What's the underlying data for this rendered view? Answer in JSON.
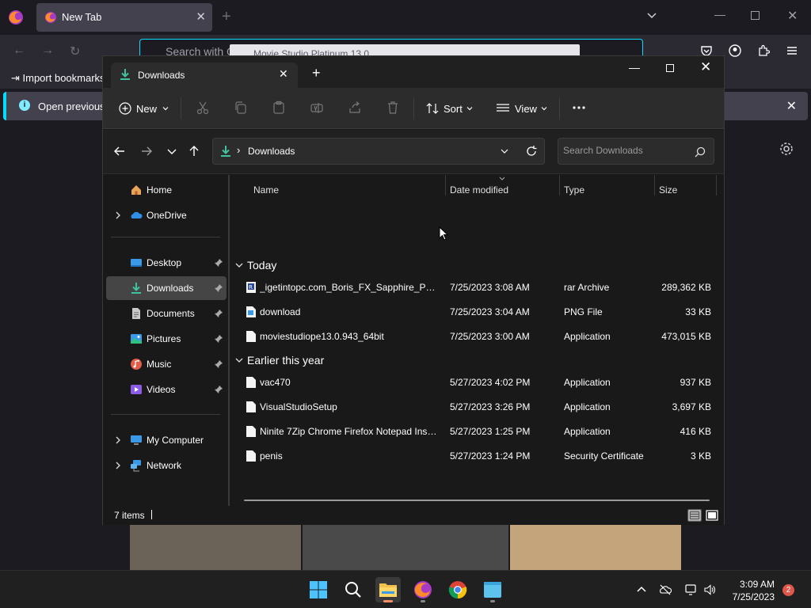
{
  "browser": {
    "tab_title": "New Tab",
    "url_placeholder": "Search with G",
    "url_suggestion": "Movie Studio Platinum 13.0",
    "import_bookmarks": "Import bookmarks...",
    "infobar_text": "Open previous t"
  },
  "explorer": {
    "tab_title": "Downloads",
    "toolbar": {
      "new_label": "New",
      "sort_label": "Sort",
      "view_label": "View"
    },
    "address": {
      "path": "Downloads",
      "search_placeholder": "Search Downloads"
    },
    "sidebar": {
      "items": [
        {
          "label": "Home",
          "icon": "home-icon"
        },
        {
          "label": "OneDrive",
          "icon": "onedrive-icon"
        },
        {
          "label": "Desktop",
          "icon": "desktop-icon"
        },
        {
          "label": "Downloads",
          "icon": "downloads-icon"
        },
        {
          "label": "Documents",
          "icon": "documents-icon"
        },
        {
          "label": "Pictures",
          "icon": "pictures-icon"
        },
        {
          "label": "Music",
          "icon": "music-icon"
        },
        {
          "label": "Videos",
          "icon": "videos-icon"
        },
        {
          "label": "My Computer",
          "icon": "computer-icon"
        },
        {
          "label": "Network",
          "icon": "network-icon"
        }
      ]
    },
    "columns": {
      "name": "Name",
      "date": "Date modified",
      "type": "Type",
      "size": "Size"
    },
    "groups": [
      {
        "label": "Today",
        "files": [
          {
            "name": "_igetintopc.com_Boris_FX_Sapphire_Plug...",
            "date": "7/25/2023 3:08 AM",
            "type": "rar Archive",
            "size": "289,362 KB"
          },
          {
            "name": "download",
            "date": "7/25/2023 3:04 AM",
            "type": "PNG File",
            "size": "33 KB"
          },
          {
            "name": "moviestudiope13.0.943_64bit",
            "date": "7/25/2023 3:00 AM",
            "type": "Application",
            "size": "473,015 KB"
          }
        ]
      },
      {
        "label": "Earlier this year",
        "files": [
          {
            "name": "vac470",
            "date": "5/27/2023 4:02 PM",
            "type": "Application",
            "size": "937 KB"
          },
          {
            "name": "VisualStudioSetup",
            "date": "5/27/2023 3:26 PM",
            "type": "Application",
            "size": "3,697 KB"
          },
          {
            "name": "Ninite 7Zip Chrome Firefox Notepad Inst...",
            "date": "5/27/2023 1:25 PM",
            "type": "Application",
            "size": "416 KB"
          },
          {
            "name": "penis",
            "date": "5/27/2023 1:24 PM",
            "type": "Security Certificate",
            "size": "3 KB"
          }
        ]
      }
    ],
    "status": {
      "item_count": "7 items"
    }
  },
  "taskbar": {
    "apps": [
      "start-button",
      "search-button",
      "file-explorer-app",
      "firefox-app",
      "chrome-app",
      "blue-window-app"
    ],
    "time": "3:09 AM",
    "date": "7/25/2023",
    "notification_count": "2"
  }
}
